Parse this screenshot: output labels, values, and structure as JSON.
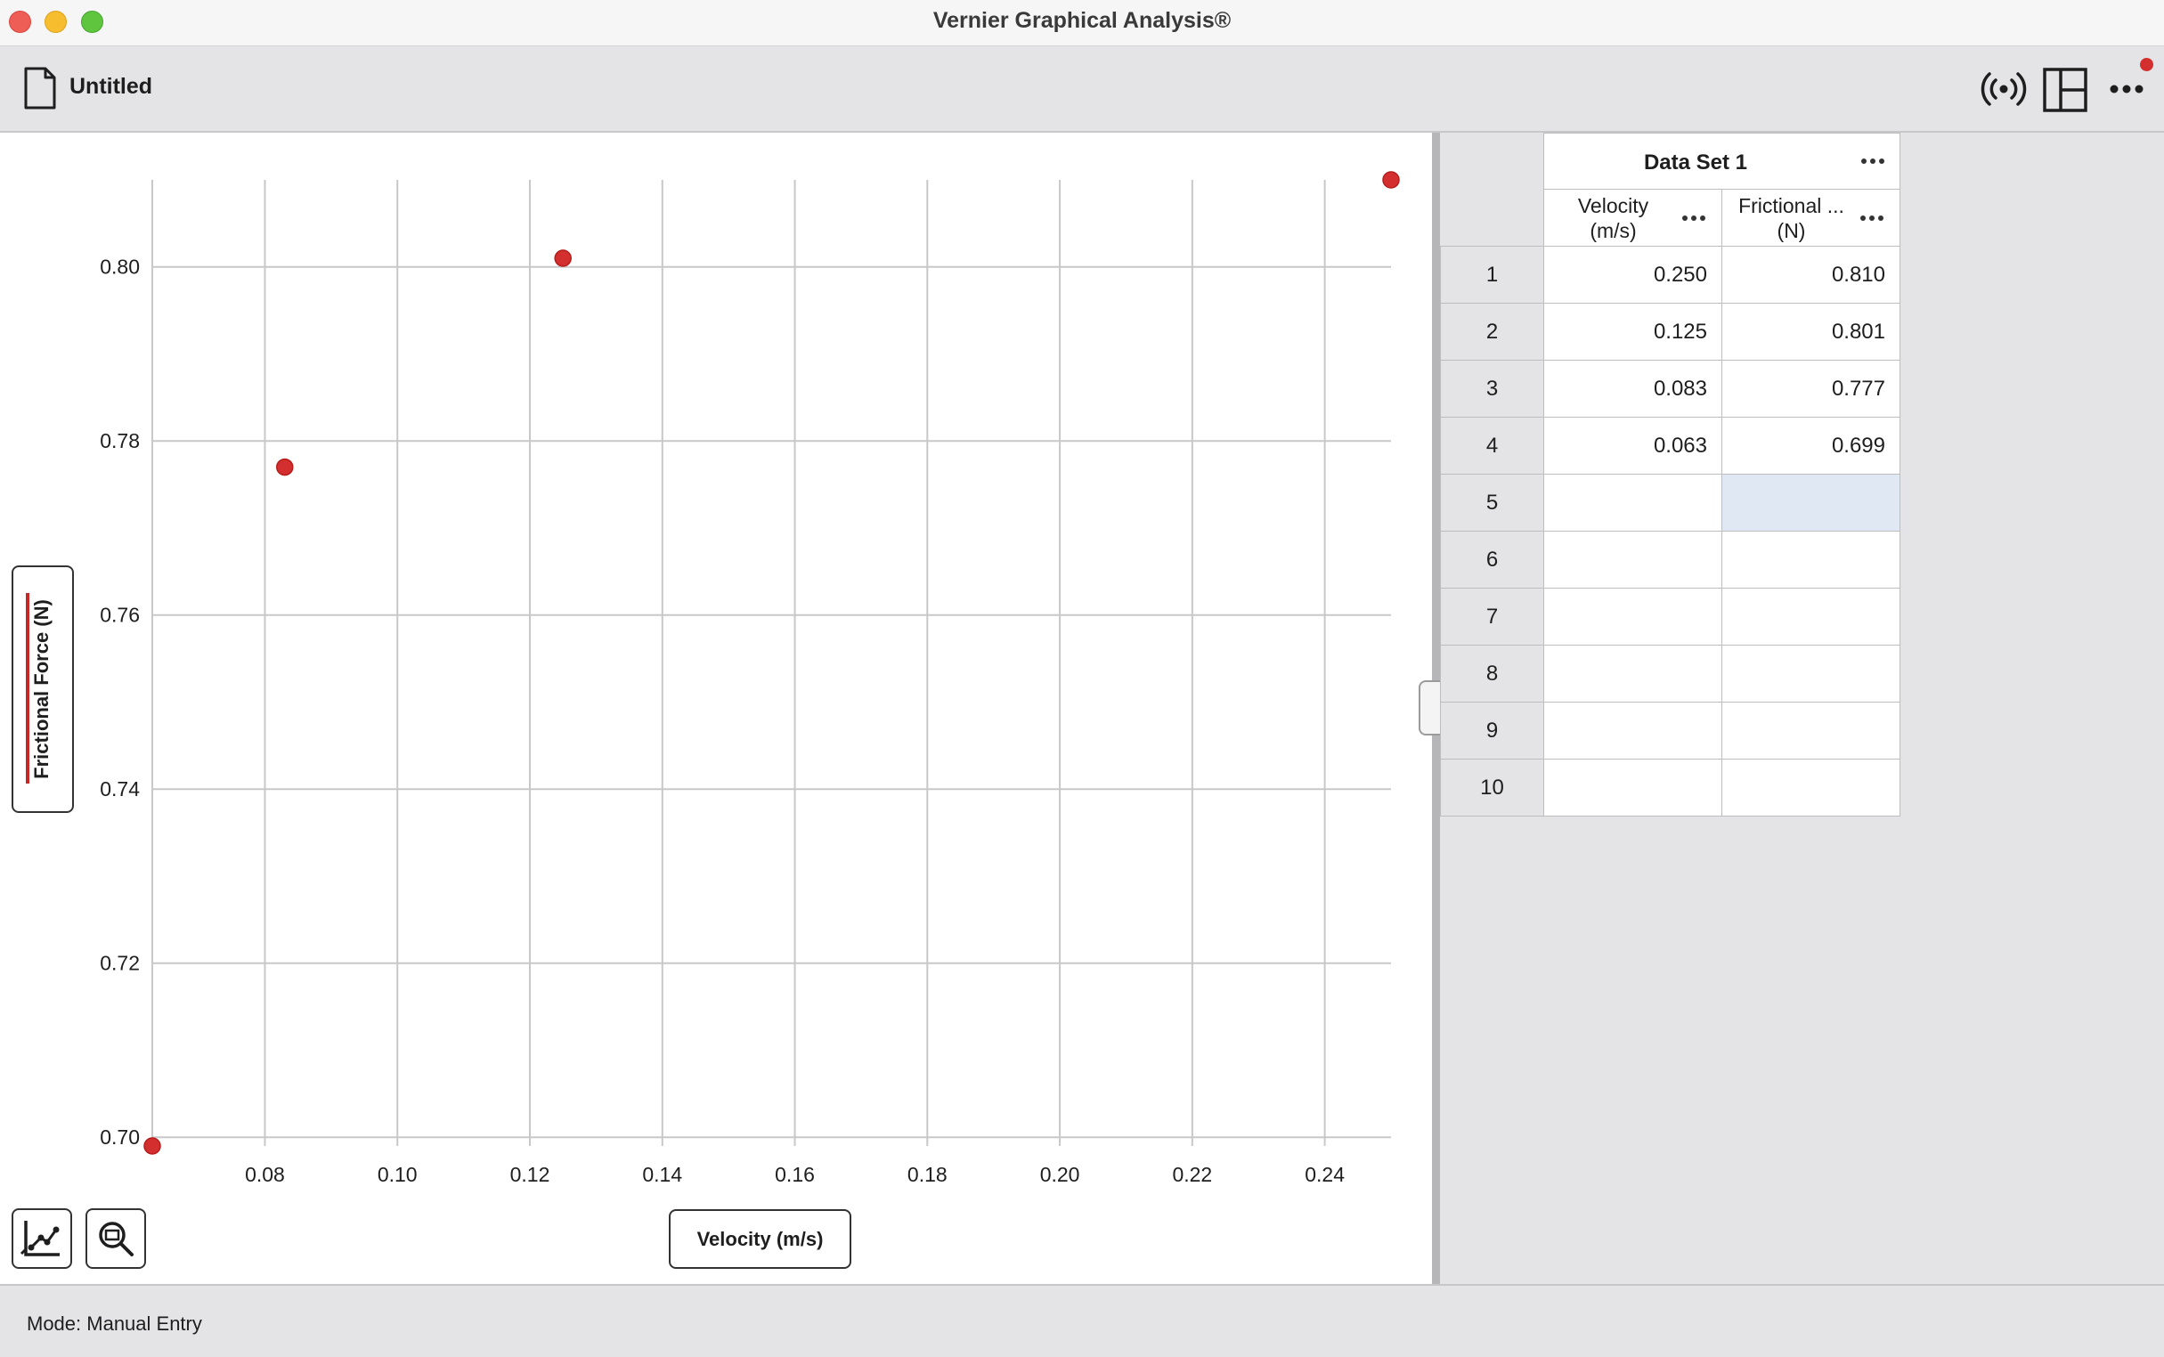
{
  "window": {
    "title": "Vernier Graphical Analysis®"
  },
  "toolbar": {
    "document_title": "Untitled"
  },
  "status": {
    "mode": "Mode: Manual Entry"
  },
  "graph": {
    "y_axis_label": "Frictional Force (N)",
    "x_axis_label": "Velocity (m/s)",
    "point_color": "#d32f2f"
  },
  "chart_data": {
    "type": "scatter",
    "title": "",
    "xlabel": "Velocity (m/s)",
    "ylabel": "Frictional Force (N)",
    "xlim": [
      0.063,
      0.25
    ],
    "ylim": [
      0.699,
      0.81
    ],
    "x_ticks": [
      "0.08",
      "0.10",
      "0.12",
      "0.14",
      "0.16",
      "0.18",
      "0.20",
      "0.22",
      "0.24"
    ],
    "y_ticks": [
      "0.70",
      "0.72",
      "0.74",
      "0.76",
      "0.78",
      "0.80"
    ],
    "grid": true,
    "series": [
      {
        "x": [
          0.25,
          0.125,
          0.083,
          0.063
        ],
        "y": [
          0.81,
          0.801,
          0.777,
          0.699
        ]
      }
    ]
  },
  "table": {
    "dataset_title": "Data Set 1",
    "columns": [
      {
        "name": "Velocity",
        "unit": "(m/s)"
      },
      {
        "name": "Frictional ...",
        "unit": "(N)"
      }
    ],
    "rows": [
      {
        "num": "1",
        "v": "0.250",
        "f": "0.810"
      },
      {
        "num": "2",
        "v": "0.125",
        "f": "0.801"
      },
      {
        "num": "3",
        "v": "0.083",
        "f": "0.777"
      },
      {
        "num": "4",
        "v": "0.063",
        "f": "0.699"
      },
      {
        "num": "5",
        "v": "",
        "f": ""
      },
      {
        "num": "6",
        "v": "",
        "f": ""
      },
      {
        "num": "7",
        "v": "",
        "f": ""
      },
      {
        "num": "8",
        "v": "",
        "f": ""
      },
      {
        "num": "9",
        "v": "",
        "f": ""
      },
      {
        "num": "10",
        "v": "",
        "f": ""
      }
    ]
  }
}
